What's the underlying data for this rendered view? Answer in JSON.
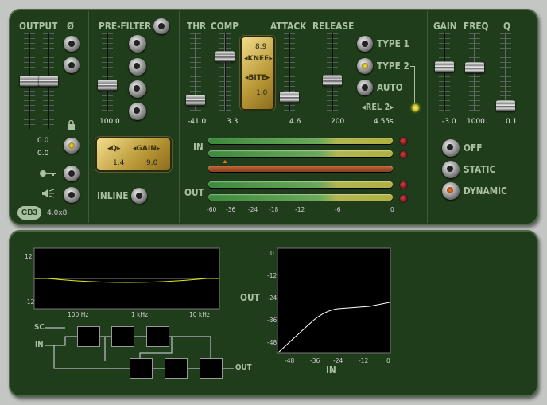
{
  "output": {
    "label": "OUTPUT",
    "phase_label": "Ø",
    "values": [
      "0.0",
      "0.0"
    ],
    "faders": [
      0.5,
      0.5
    ]
  },
  "prefilter": {
    "label": "PRE-FILTER",
    "value": "100.0",
    "fader": 0.66,
    "q_label": "◂Q▸",
    "gain_label": "◂GAIN▸",
    "q_value": "1.4",
    "gain_value": "9.0",
    "inline_label": "INLINE"
  },
  "version": {
    "logo": "CB3",
    "text": "4.0x8"
  },
  "comp": {
    "labels": {
      "thr": "THR",
      "comp": "COMP",
      "attack": "ATTACK",
      "release": "RELEASE"
    },
    "values": {
      "thr": "-41.0",
      "comp": "3.3",
      "attack": "4.6",
      "release": "200",
      "rel2": "4.55s"
    },
    "faders": {
      "thr": 0.86,
      "comp": 0.3,
      "attack": 0.82,
      "release": 0.6
    },
    "knee_value": "8.9",
    "knee_label": "◂KNEE▸",
    "bite_label": "◂BITE▸",
    "bite_value": "1.0",
    "types": [
      "TYPE 1",
      "TYPE 2",
      "AUTO"
    ],
    "selected_type": "TYPE 2",
    "rel2_label": "◂REL 2▸"
  },
  "meters": {
    "in_label": "IN",
    "out_label": "OUT",
    "scale": [
      "-60",
      "-36",
      "-24",
      "-18",
      "-12",
      "-6",
      "0"
    ]
  },
  "eq": {
    "labels": {
      "gain": "GAIN",
      "freq": "FREQ",
      "q": "Q"
    },
    "values": {
      "gain": "-3.0",
      "freq": "1000.",
      "q": "0.1"
    },
    "faders": {
      "gain": 0.43,
      "freq": 0.44,
      "q": 0.93
    },
    "modes": [
      "OFF",
      "STATIC",
      "DYNAMIC"
    ],
    "selected_mode": "DYNAMIC"
  },
  "eq_graph": {
    "y_labels": [
      "12",
      "-12"
    ],
    "x_labels": [
      "100 Hz",
      "1 kHz",
      "10 kHz"
    ]
  },
  "routing": {
    "sc": "SC",
    "in": "IN",
    "out": "OUT"
  },
  "transfer": {
    "out_label": "OUT",
    "in_label": "IN",
    "y_labels": [
      "0",
      "-12",
      "-24",
      "-36",
      "-48"
    ],
    "x_labels": [
      "-48",
      "-36",
      "-24",
      "-12",
      "0"
    ]
  },
  "colors": {
    "panel": "#203d1b",
    "label": "#a9c1a1",
    "eq_curve": "#e8e81a"
  }
}
